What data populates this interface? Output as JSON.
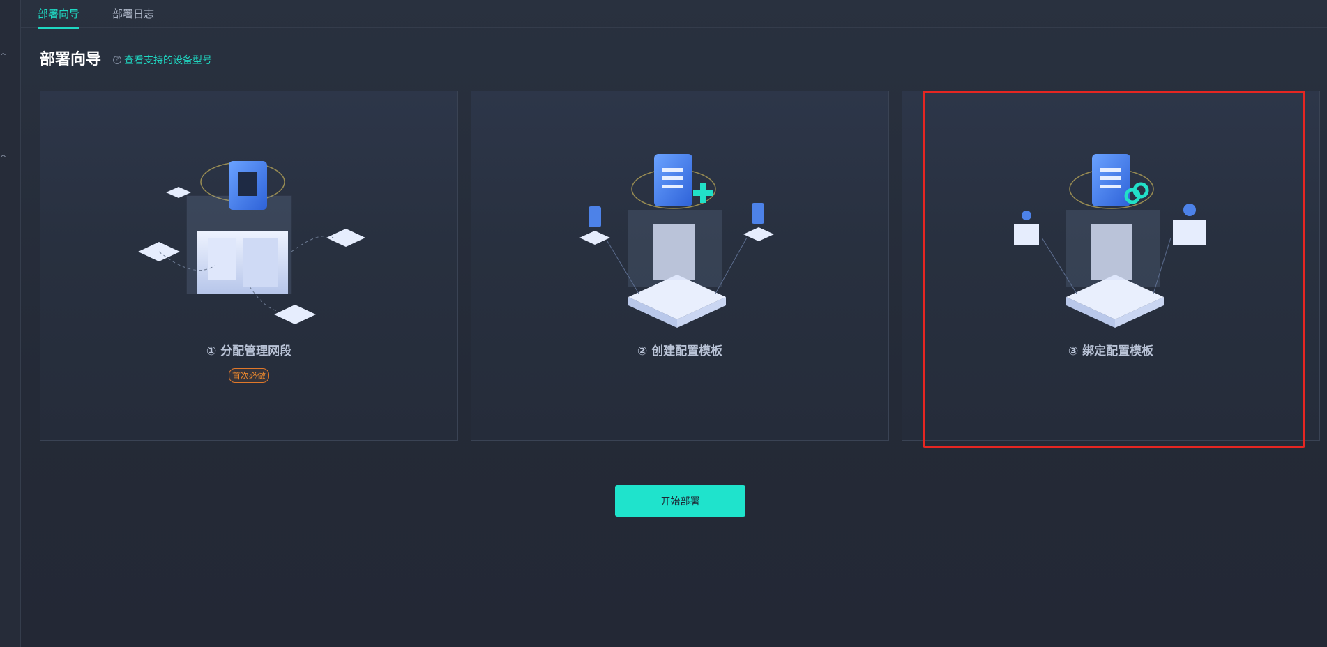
{
  "tabs": [
    {
      "label": "部署向导",
      "active": true
    },
    {
      "label": "部署日志",
      "active": false
    }
  ],
  "header": {
    "title": "部署向导",
    "support_link": "查看支持的设备型号",
    "help_glyph": "?"
  },
  "steps": [
    {
      "title": "① 分配管理网段",
      "badge": "首次必做",
      "icon": "network-segment-illustration"
    },
    {
      "title": "② 创建配置模板",
      "icon": "create-template-illustration"
    },
    {
      "title": "③ 绑定配置模板",
      "icon": "bind-template-illustration"
    }
  ],
  "start_button": "开始部署",
  "colors": {
    "accent": "#1fd8c2",
    "button": "#1fe3cc",
    "badge": "#f08a2e",
    "highlight": "#e52622",
    "background": "#252b39"
  }
}
